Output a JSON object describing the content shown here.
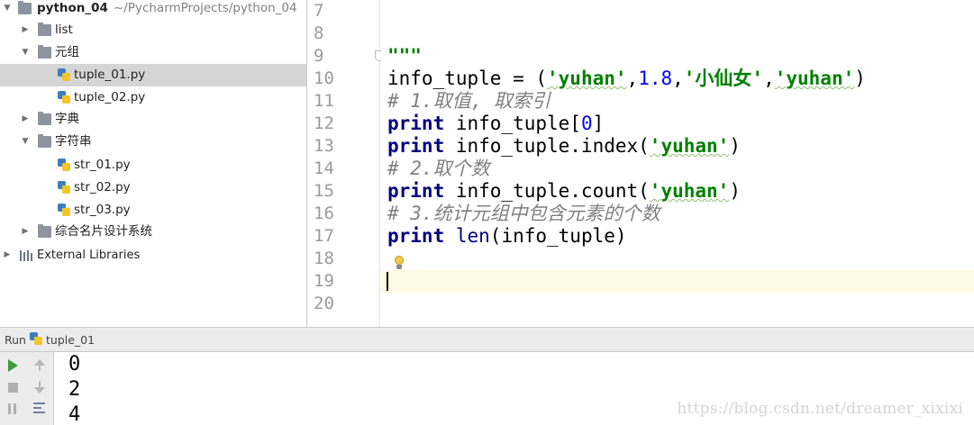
{
  "project_tree": {
    "root": {
      "name": "python_04",
      "path": "~/PycharmProjects/python_04"
    },
    "items": [
      {
        "label": "list",
        "kind": "folder",
        "expanded": false
      },
      {
        "label": "元组",
        "kind": "folder",
        "expanded": true
      },
      {
        "label": "tuple_01.py",
        "kind": "python-file",
        "selected": true
      },
      {
        "label": "tuple_02.py",
        "kind": "python-file"
      },
      {
        "label": "字典",
        "kind": "folder",
        "expanded": false
      },
      {
        "label": "字符串",
        "kind": "folder",
        "expanded": true
      },
      {
        "label": "str_01.py",
        "kind": "python-file"
      },
      {
        "label": "str_02.py",
        "kind": "python-file"
      },
      {
        "label": "str_03.py",
        "kind": "python-file"
      },
      {
        "label": "综合名片设计系统",
        "kind": "folder",
        "expanded": false
      },
      {
        "label": "External Libraries",
        "kind": "libraries",
        "expanded": false
      }
    ]
  },
  "editor": {
    "line_numbers": [
      "7",
      "8",
      "9",
      "10",
      "11",
      "12",
      "13",
      "14",
      "15",
      "16",
      "17",
      "18",
      "19",
      "20"
    ],
    "current_line": "19",
    "code": {
      "l9_docstring": "\"\"\"",
      "l10_var": "info_tuple = (",
      "l10_s1": "'yuhan'",
      "l10_comma1": ",",
      "l10_num": "1.8",
      "l10_comma2": ",",
      "l10_s2": "'小仙女'",
      "l10_comma3": ",",
      "l10_s3": "'yuhan'",
      "l10_close": ")",
      "l11_comment": "# 1.取值, 取索引",
      "l12_kw": "print",
      "l12_a": " info_tuple[",
      "l12_num": "0",
      "l12_b": "]",
      "l13_kw": "print",
      "l13_a": " info_tuple.index(",
      "l13_s": "'yuhan'",
      "l13_b": ")",
      "l14_comment": "# 2.取个数",
      "l15_kw": "print",
      "l15_a": " info_tuple.count(",
      "l15_s": "'yuhan'",
      "l15_b": ")",
      "l16_comment": "# 3.统计元组中包含元素的个数",
      "l17_kw": "print",
      "l17_fn": " len",
      "l17_b": "(info_tuple)"
    }
  },
  "run_panel": {
    "title": "Run",
    "config_name": "tuple_01",
    "output": [
      "0",
      "2",
      "4"
    ]
  },
  "watermark": "https://blog.csdn.net/dreamer_xixixi",
  "colors": {
    "keyword": "#000080",
    "string": "#008000",
    "number": "#0000ff",
    "comment": "#808080",
    "caret_line": "#fffae3",
    "selection": "#d5d5d5"
  }
}
